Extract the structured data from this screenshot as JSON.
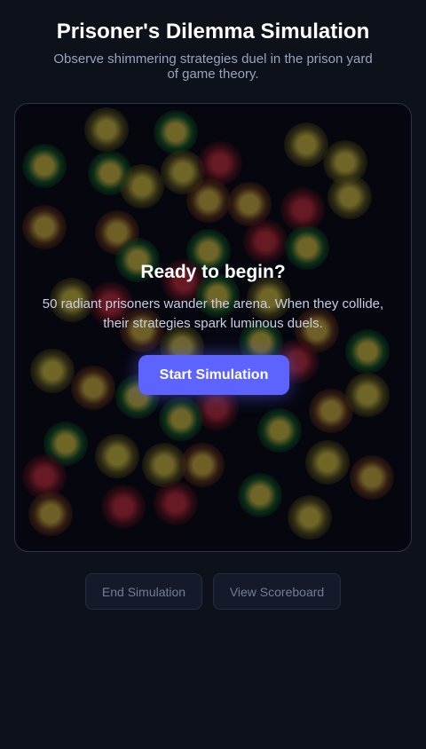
{
  "header": {
    "title": "Prisoner's Dilemma Simulation",
    "subtitle": "Observe shimmering strategies duel in the prison yard of game theory."
  },
  "arena": {
    "status_title": "Ready to begin?",
    "status_text": "50 radiant prisoners wander the arena. When they collide, their strategies spark luminous duels.",
    "start_label": "Start Simulation"
  },
  "controls": {
    "end_label": "End Simulation",
    "scoreboard_label": "View Scoreboard"
  },
  "colors": {
    "accent": "#5c63ff",
    "background": "#0d111a",
    "arena_background": "#05070e"
  }
}
